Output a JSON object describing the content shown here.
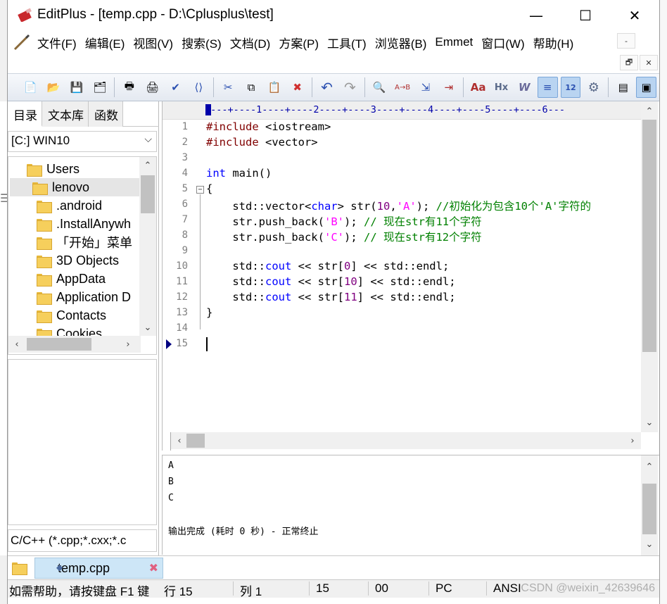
{
  "window": {
    "title": "EditPlus - [temp.cpp - D:\\Cplusplus\\test]",
    "minimize": "—",
    "maximize": "☐",
    "close": "✕"
  },
  "menu": {
    "items": [
      "文件(F)",
      "编辑(E)",
      "视图(V)",
      "搜索(S)",
      "文档(D)",
      "方案(P)",
      "工具(T)",
      "浏览器(B)",
      "Emmet",
      "窗口(W)",
      "帮助(H)"
    ],
    "mdi_minimize": "-",
    "mdi_restore": "🗗",
    "mdi_close": "✕"
  },
  "toolbar": {
    "buttons": [
      {
        "icon": "new-file-icon",
        "glyph": "📄"
      },
      {
        "icon": "open-folder-icon",
        "glyph": "📂"
      },
      {
        "icon": "save-icon",
        "glyph": "💾"
      },
      {
        "icon": "save-all-icon",
        "glyph": "🗂"
      },
      {
        "icon": "print-preview-icon",
        "glyph": "🖶"
      },
      {
        "icon": "print-icon",
        "glyph": "🖨"
      },
      {
        "icon": "spell-check-icon",
        "glyph": "✔"
      },
      {
        "icon": "browser-view-icon",
        "glyph": "⟨⟩"
      },
      {
        "icon": "cut-icon",
        "glyph": "✂"
      },
      {
        "icon": "copy-icon",
        "glyph": "⧉"
      },
      {
        "icon": "paste-icon",
        "glyph": "📋"
      },
      {
        "icon": "delete-icon",
        "glyph": "✖"
      },
      {
        "icon": "undo-icon",
        "glyph": "↶"
      },
      {
        "icon": "redo-icon",
        "glyph": "↷"
      },
      {
        "icon": "find-icon",
        "glyph": "🔍"
      },
      {
        "icon": "replace-icon",
        "glyph": "A→B"
      },
      {
        "icon": "go-to-icon",
        "glyph": "⇲"
      },
      {
        "icon": "indent-icon",
        "glyph": "⇥"
      },
      {
        "icon": "font-icon",
        "glyph": "Aa"
      },
      {
        "icon": "hex-view-icon",
        "glyph": "Hx"
      },
      {
        "icon": "word-wrap-icon",
        "glyph": "W"
      },
      {
        "icon": "line-number-icon",
        "glyph": "≡"
      },
      {
        "icon": "column-ruler-icon",
        "glyph": "12"
      },
      {
        "icon": "settings-icon",
        "glyph": "⚙"
      },
      {
        "icon": "output-window-icon",
        "glyph": "▤"
      },
      {
        "icon": "cliptext-window-icon",
        "glyph": "▣"
      }
    ]
  },
  "sidebar": {
    "tabs": [
      "目录",
      "文本库",
      "函数"
    ],
    "drive": "[C:] WIN10",
    "tree": [
      "Users",
      "lenovo",
      ".android",
      ".InstallAnywh",
      "「开始」菜单",
      "3D Objects",
      "AppData",
      "Application D",
      "Contacts",
      "Cookies"
    ],
    "filter": "C/C++ (*.cpp;*.cxx;*.c"
  },
  "editor": {
    "ruler": "----+----1----+----2----+----3----+----4----+----5----+----6---",
    "line_numbers": [
      "1",
      "2",
      "3",
      "4",
      "5",
      "6",
      "7",
      "8",
      "9",
      "10",
      "11",
      "12",
      "13",
      "14",
      "15"
    ],
    "fold_marker": "−",
    "code": {
      "l1_pp": "#include",
      "l1_rest": " <iostream>",
      "l2_pp": "#include",
      "l2_rest": " <vector>",
      "l4_kw": "int",
      "l4_rest": " main()",
      "l5": "{",
      "l6_a": "    std::vector<",
      "l6_kw": "char",
      "l6_b": "> str(",
      "l6_num": "10",
      "l6_c": ",",
      "l6_str": "'A'",
      "l6_d": "); ",
      "l6_comment": "//初始化为包含10个'A'字符的",
      "l7_a": "    str.push_back(",
      "l7_str": "'B'",
      "l7_b": "); ",
      "l7_comment": "// 现在str有11个字符",
      "l8_a": "    str.push_back(",
      "l8_str": "'C'",
      "l8_b": "); ",
      "l8_comment": "// 现在str有12个字符",
      "l10_a": "    std::",
      "l10_kw": "cout",
      "l10_b": " << str[",
      "l10_num": "0",
      "l10_c": "] << std::endl;",
      "l11_a": "    std::",
      "l11_kw": "cout",
      "l11_b": " << str[",
      "l11_num": "10",
      "l11_c": "] << std::endl;",
      "l12_a": "    std::",
      "l12_kw": "cout",
      "l12_b": " << str[",
      "l12_num": "11",
      "l12_c": "] << std::endl;",
      "l13": "}"
    }
  },
  "output": {
    "lines": [
      "A",
      "B",
      "C",
      "",
      "输出完成 (耗时 0 秒) - 正常终止"
    ]
  },
  "doc_tab": {
    "name": "temp.cpp",
    "close": "✖"
  },
  "status": {
    "help": "如需帮助，请按键盘 F1 键",
    "row": "行 15",
    "col": "列 1",
    "col_value": "15",
    "code": "00",
    "line_ending": "PC",
    "encoding": "ANSI",
    "watermark": "CSDN @weixin_42639646"
  }
}
